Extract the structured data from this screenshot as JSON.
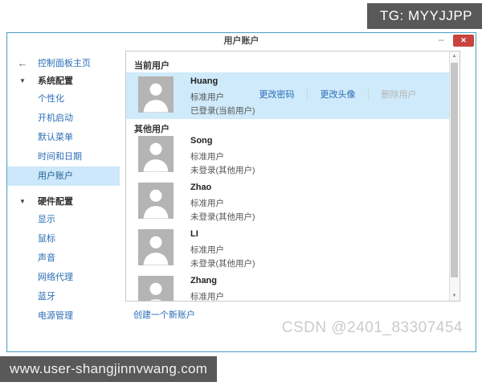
{
  "badge": {
    "text": "TG: MYYJJPP",
    "bg": "#595959"
  },
  "window": {
    "title": "用户账户",
    "minimize_label": "–",
    "close_label": "✕"
  },
  "sidebar": {
    "back_icon": "←",
    "home_label": "控制面板主页",
    "caret": "▼",
    "sections": [
      {
        "label": "系统配置",
        "items": [
          {
            "label": "个性化",
            "selected": false
          },
          {
            "label": "开机启动",
            "selected": false
          },
          {
            "label": "默认菜单",
            "selected": false
          },
          {
            "label": "时间和日期",
            "selected": false
          },
          {
            "label": "用户账户",
            "selected": true
          }
        ]
      },
      {
        "label": "硬件配置",
        "items": [
          {
            "label": "显示",
            "selected": false
          },
          {
            "label": "鼠标",
            "selected": false
          },
          {
            "label": "声音",
            "selected": false
          },
          {
            "label": "网络代理",
            "selected": false
          },
          {
            "label": "蓝牙",
            "selected": false
          },
          {
            "label": "电源管理",
            "selected": false
          }
        ]
      }
    ]
  },
  "main": {
    "current_user_header": "当前用户",
    "other_users_header": "其他用户",
    "current_user": {
      "name": "Huang",
      "role": "标准用户",
      "status": "已登录(当前用户)",
      "actions": [
        {
          "label": "更改密码",
          "enabled": true
        },
        {
          "label": "更改头像",
          "enabled": true
        },
        {
          "label": "删除用户",
          "enabled": false
        }
      ]
    },
    "other_users": [
      {
        "name": "Song",
        "role": "标准用户",
        "status": "未登录(其他用户)"
      },
      {
        "name": "Zhao",
        "role": "标准用户",
        "status": "未登录(其他用户)"
      },
      {
        "name": "LI",
        "role": "标准用户",
        "status": "未登录(其他用户)"
      },
      {
        "name": "Zhang",
        "role": "标准用户",
        "status": ""
      }
    ],
    "create_link": "创建一个新账户"
  },
  "watermark": "CSDN @2401_83307454",
  "bottom_bar": {
    "text": "www.user-shangjinnvwang.com"
  },
  "colors": {
    "accent_link": "#2a6db5",
    "row_highlight": "#cfeafa",
    "sidebar_selected": "#cde8fa",
    "window_border": "#57a3c9",
    "close_button": "#c9443e",
    "badge_bg": "#595959",
    "avatar_bg": "#b4b4b4"
  }
}
